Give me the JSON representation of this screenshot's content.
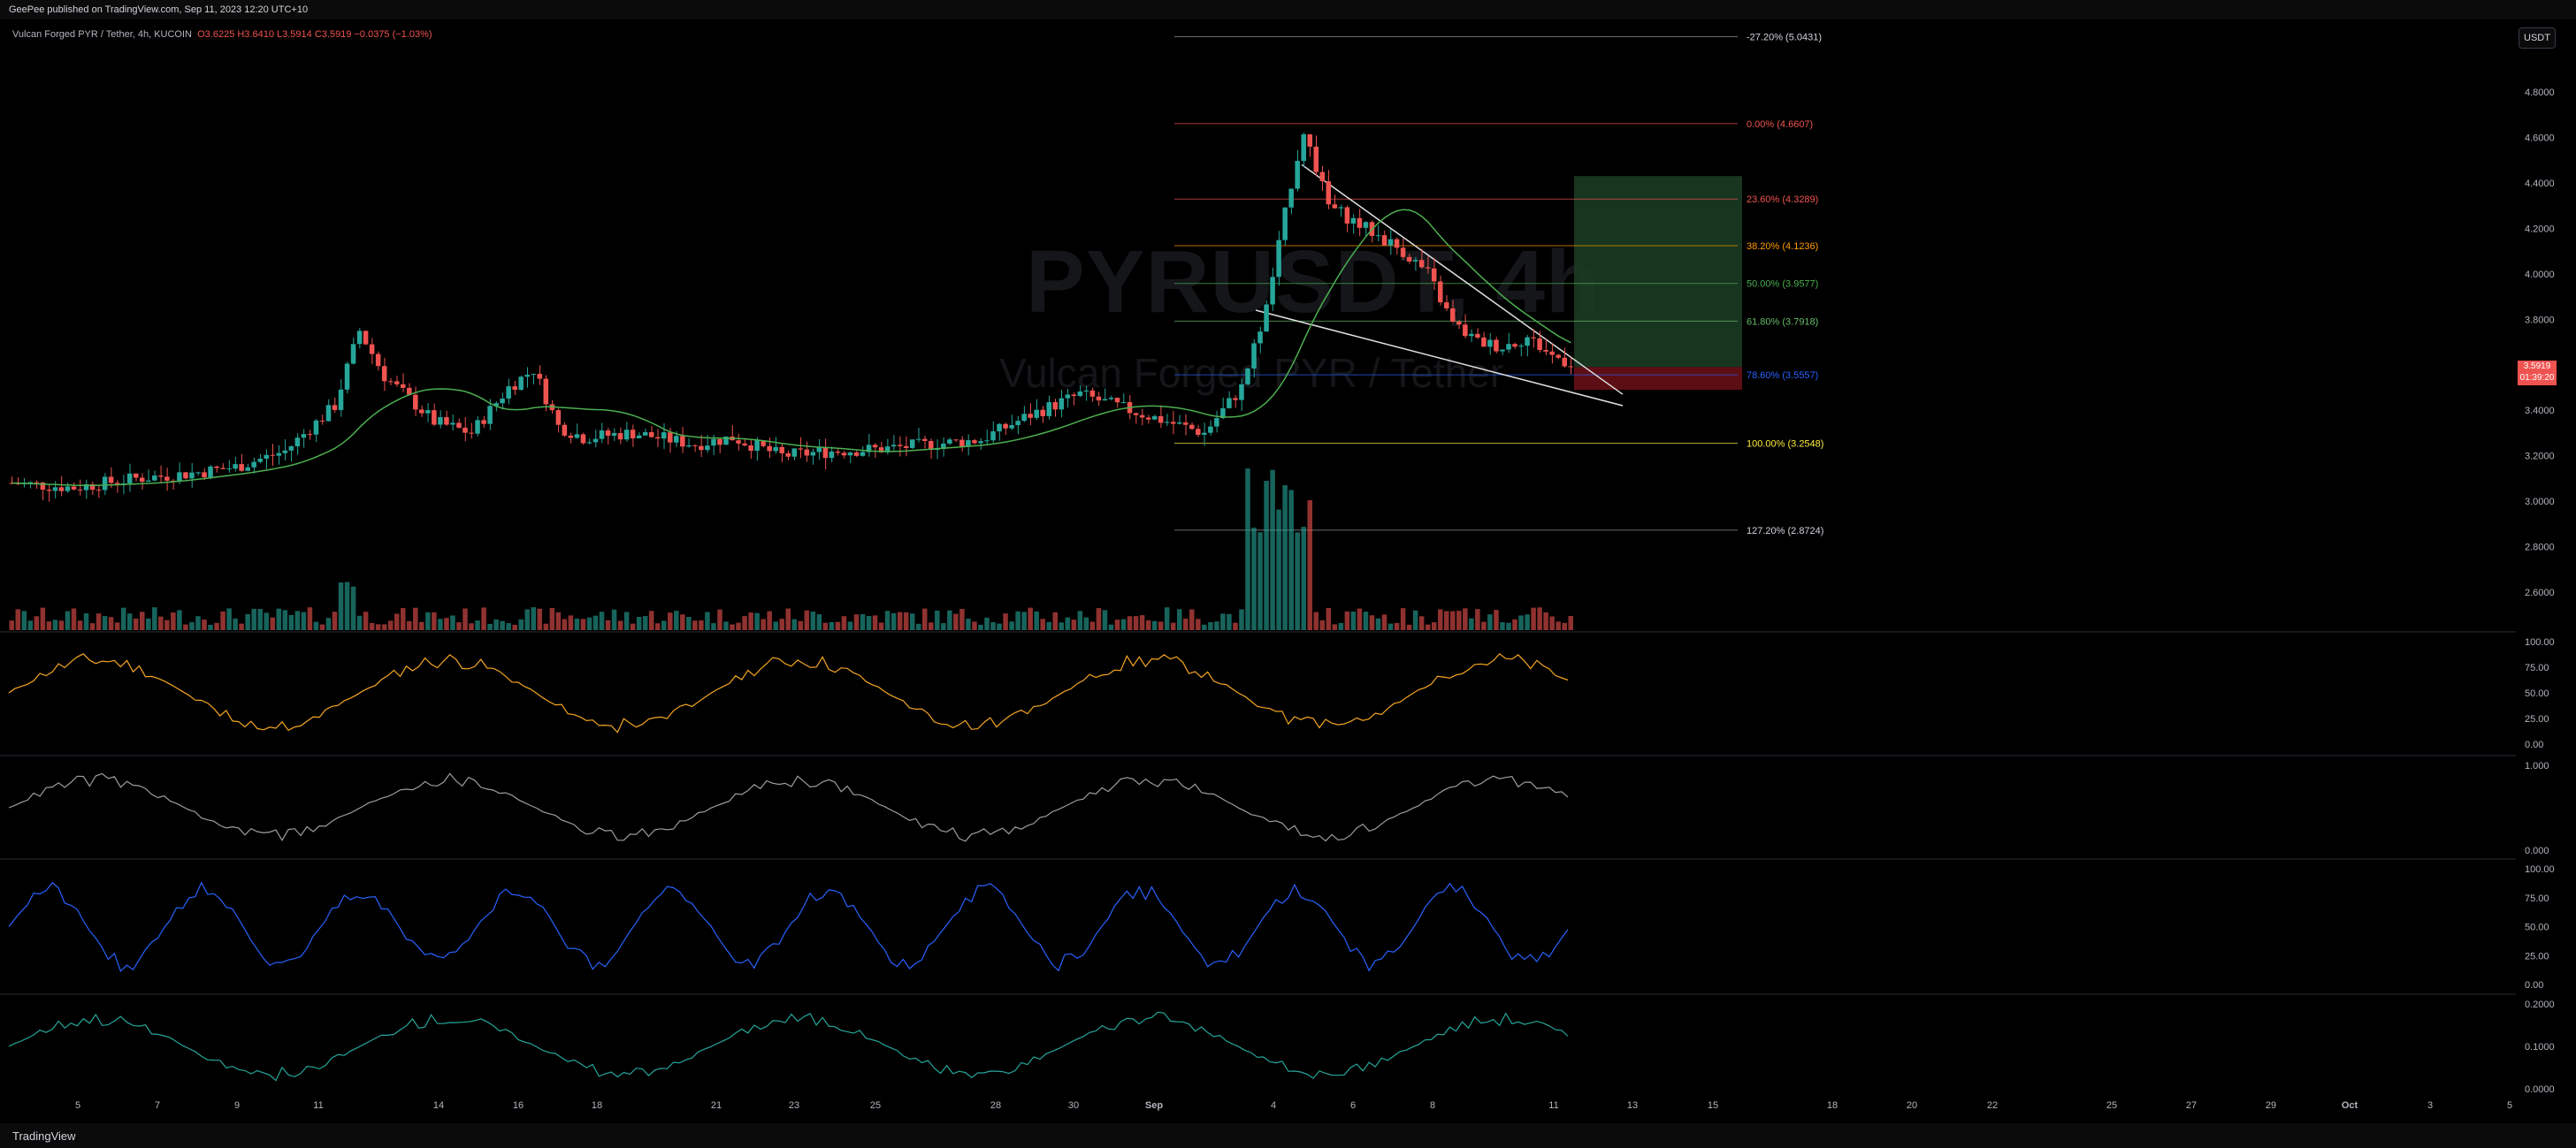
{
  "header": {
    "published": "GeePee published on TradingView.com, Sep 11, 2023 12:20 UTC+10",
    "symbol": "Vulcan Forged PYR / Tether, 4h, KUCOIN",
    "ohlc": "O3.6225 H3.6410 L3.5914 C3.5919 −0.0375 (−1.03%)",
    "currency": "USDT"
  },
  "watermark": {
    "ticker": "PYRUSDT, 4h",
    "name": "Vulcan Forged PYR / Tether"
  },
  "footer": {
    "brand": "TradingView"
  },
  "colors": {
    "up": "#26a69a",
    "down": "#ef5350",
    "bg": "#000000",
    "fib_green": "#1b3b22",
    "fib_red": "#5d0e14"
  },
  "last_price": {
    "value": "3.5919",
    "countdown": "01:39:20"
  },
  "chart_data": {
    "type": "candlestick",
    "x_ticks": [
      "5",
      "7",
      "9",
      "11",
      "14",
      "16",
      "18",
      "21",
      "23",
      "25",
      "28",
      "30",
      "Sep",
      "4",
      "6",
      "8",
      "11",
      "13",
      "15",
      "18",
      "20",
      "22",
      "25",
      "27",
      "29",
      "Oct",
      "3",
      "5"
    ],
    "price_axis": {
      "ticks": [
        "4.8000",
        "4.6000",
        "4.4000",
        "4.2000",
        "4.0000",
        "3.8000",
        "3.6000",
        "3.4000",
        "3.2000",
        "3.0000",
        "2.8000",
        "2.6000"
      ],
      "ylim": [
        2.5,
        5.2
      ]
    },
    "fibonacci": [
      {
        "label": "-27.20% (5.0431)",
        "price": 5.0431
      },
      {
        "label": "0.00% (4.6607)",
        "price": 4.6607,
        "color": "#ef5350"
      },
      {
        "label": "23.60% (4.3289)",
        "price": 4.3289,
        "color": "#ef5350"
      },
      {
        "label": "38.20% (4.1236)",
        "price": 4.1236,
        "color": "#ff9800"
      },
      {
        "label": "50.00% (3.9577)",
        "price": 3.9577,
        "color": "#4caf50"
      },
      {
        "label": "61.80% (3.7918)",
        "price": 3.7918,
        "color": "#66bb6a"
      },
      {
        "label": "78.60% (3.5557)",
        "price": 3.5557,
        "color": "#2962ff"
      },
      {
        "label": "100.00% (3.2548)",
        "price": 3.2548,
        "color": "#ffeb3b"
      },
      {
        "label": "127.20% (2.8724)",
        "price": 2.8724
      }
    ],
    "close_path": [
      [
        0,
        3.08
      ],
      [
        10,
        3.06
      ],
      [
        20,
        3.1
      ],
      [
        28,
        3.12
      ],
      [
        36,
        3.15
      ],
      [
        44,
        3.22
      ],
      [
        52,
        3.42
      ],
      [
        56,
        3.75
      ],
      [
        60,
        3.55
      ],
      [
        64,
        3.45
      ],
      [
        68,
        3.35
      ],
      [
        74,
        3.3
      ],
      [
        80,
        3.5
      ],
      [
        84,
        3.58
      ],
      [
        88,
        3.33
      ],
      [
        92,
        3.28
      ],
      [
        100,
        3.3
      ],
      [
        110,
        3.25
      ],
      [
        116,
        3.28
      ],
      [
        124,
        3.2
      ],
      [
        132,
        3.22
      ],
      [
        140,
        3.23
      ],
      [
        148,
        3.25
      ],
      [
        156,
        3.27
      ],
      [
        164,
        3.38
      ],
      [
        172,
        3.47
      ],
      [
        180,
        3.4
      ],
      [
        186,
        3.35
      ],
      [
        192,
        3.3
      ],
      [
        198,
        3.5
      ],
      [
        202,
        3.85
      ],
      [
        206,
        4.4
      ],
      [
        208,
        4.63
      ],
      [
        212,
        4.3
      ],
      [
        218,
        4.2
      ],
      [
        224,
        4.1
      ],
      [
        228,
        4.0
      ],
      [
        232,
        3.78
      ],
      [
        236,
        3.7
      ],
      [
        240,
        3.68
      ],
      [
        244,
        3.72
      ],
      [
        248,
        3.64
      ],
      [
        252,
        3.6
      ]
    ],
    "y_bounds": [
      2.6,
      4.8
    ]
  },
  "oscillators": {
    "rsi": [
      "100.00",
      "75.00",
      "50.00",
      "25.00",
      "0.00"
    ],
    "cycle": [
      "1.000",
      "0.000"
    ],
    "stoch": [
      "100.00",
      "75.00",
      "50.00",
      "25.00",
      "0.00"
    ],
    "macd": [
      "0.2000",
      "0.1000",
      "0.0000"
    ]
  }
}
